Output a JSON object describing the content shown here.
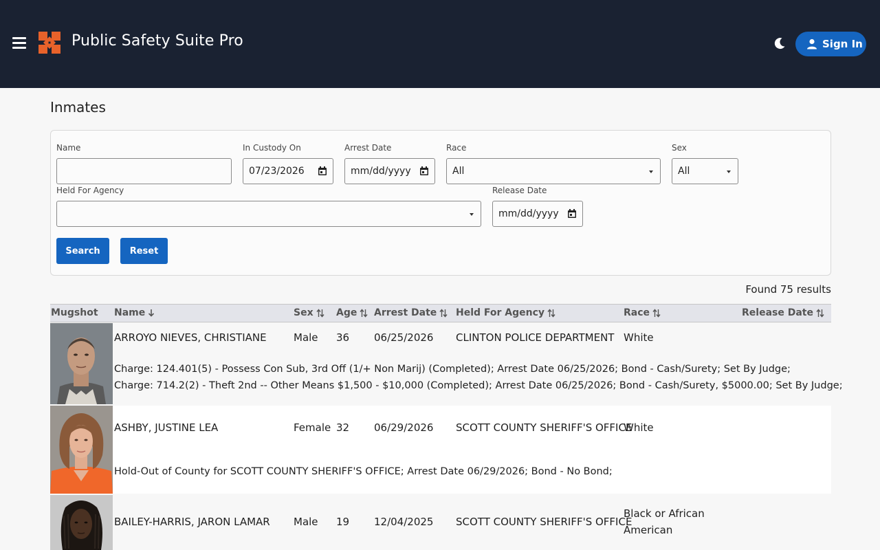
{
  "header": {
    "title": "Public Safety Suite Pro",
    "signin_label": "Sign In",
    "colors": {
      "bar": "#1a2232",
      "accent": "#1565c0",
      "logo": "#e8622a"
    }
  },
  "page": {
    "title": "Inmates"
  },
  "filters": {
    "name": {
      "label": "Name",
      "value": ""
    },
    "in_custody_on": {
      "label": "In Custody On",
      "value": "07/23/2026"
    },
    "arrest_date": {
      "label": "Arrest Date",
      "value": "mm/dd/yyyy"
    },
    "race": {
      "label": "Race",
      "value": "All"
    },
    "sex": {
      "label": "Sex",
      "value": "All"
    },
    "held_for_agency": {
      "label": "Held For Agency",
      "value": ""
    },
    "release_date": {
      "label": "Release Date",
      "value": "mm/dd/yyyy"
    },
    "search_label": "Search",
    "reset_label": "Reset"
  },
  "results": {
    "count_text": "Found 75 results"
  },
  "table": {
    "columns": [
      "Mugshot",
      "Name",
      "Sex",
      "Age",
      "Arrest Date",
      "Held For Agency",
      "Race",
      "Release Date"
    ],
    "rows": [
      {
        "name": "ARROYO NIEVES, CHRISTIANE",
        "sex": "Male",
        "age": "36",
        "arrest_date": "06/25/2026",
        "agency": "CLINTON POLICE DEPARTMENT",
        "race": "White",
        "release_date": "",
        "charges": [
          "Charge: 124.401(5) - Possess Con Sub, 3rd Off (1/+ Non Marij) (Completed); Arrest Date 06/25/2026; Bond - Cash/Surety; Set By Judge;",
          "Charge: 714.2(2) - Theft 2nd -- Other Means $1,500 - $10,000 (Completed); Arrest Date 06/25/2026; Bond - Cash/Surety, $5000.00; Set By Judge;"
        ]
      },
      {
        "name": "ASHBY, JUSTINE LEA",
        "sex": "Female",
        "age": "32",
        "arrest_date": "06/29/2026",
        "agency": "SCOTT COUNTY SHERIFF'S OFFICE",
        "race": "White",
        "release_date": "",
        "charges": [
          "Hold-Out of County for SCOTT COUNTY SHERIFF'S OFFICE; Arrest Date 06/29/2026; Bond - No Bond;"
        ]
      },
      {
        "name": "BAILEY-HARRIS, JARON LAMAR",
        "sex": "Male",
        "age": "19",
        "arrest_date": "12/04/2025",
        "agency": "SCOTT COUNTY SHERIFF'S OFFICE",
        "race_line1": "Black or African",
        "race_line2": "American",
        "release_date": "",
        "charges": []
      }
    ]
  }
}
